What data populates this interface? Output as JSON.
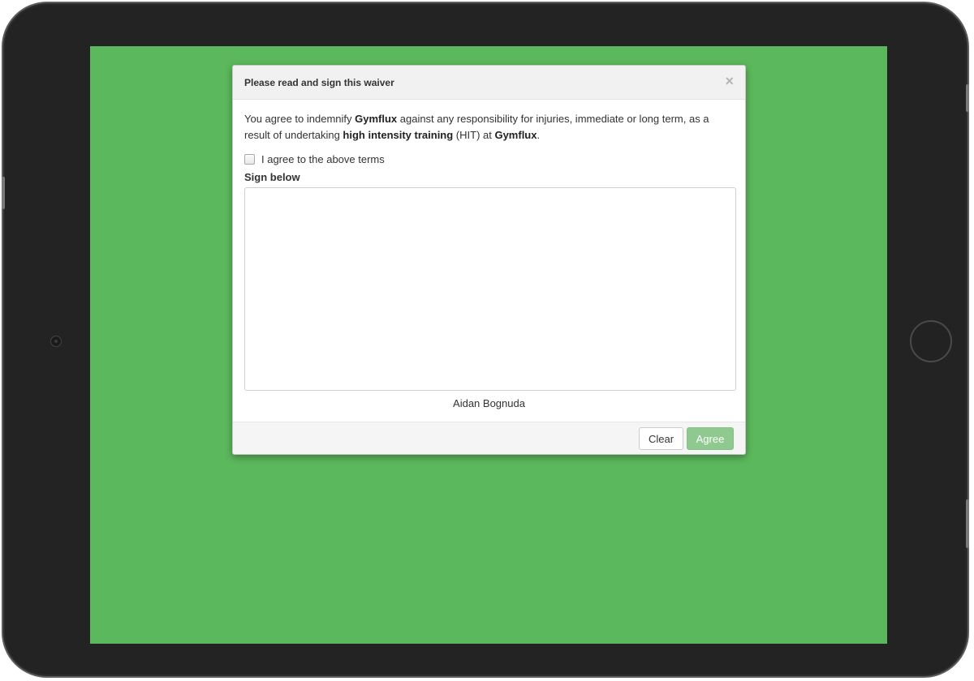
{
  "modal": {
    "title": "Please read and sign this waiver",
    "close_icon": "×",
    "terms": {
      "part1": "You agree to indemnify ",
      "brand": "Gymflux",
      "part2": " against any responsibility for injuries, immediate or long term, as a result of undertaking ",
      "activity": "high intensity training",
      "part3": " (HIT) at ",
      "brand2": "Gymflux",
      "part4": "."
    },
    "agree_checkbox": {
      "label": "I agree to the above terms",
      "checked": false
    },
    "sign_label": "Sign below",
    "signer_name": "Aidan Bognuda",
    "buttons": {
      "clear": "Clear",
      "agree": "Agree"
    }
  },
  "colors": {
    "screen_background": "#5cb85c",
    "agree_button": "#8fc98f",
    "device_bezel": "#232323"
  },
  "icons": {
    "close": "close-icon",
    "camera": "camera-icon",
    "home": "home-button-icon"
  }
}
